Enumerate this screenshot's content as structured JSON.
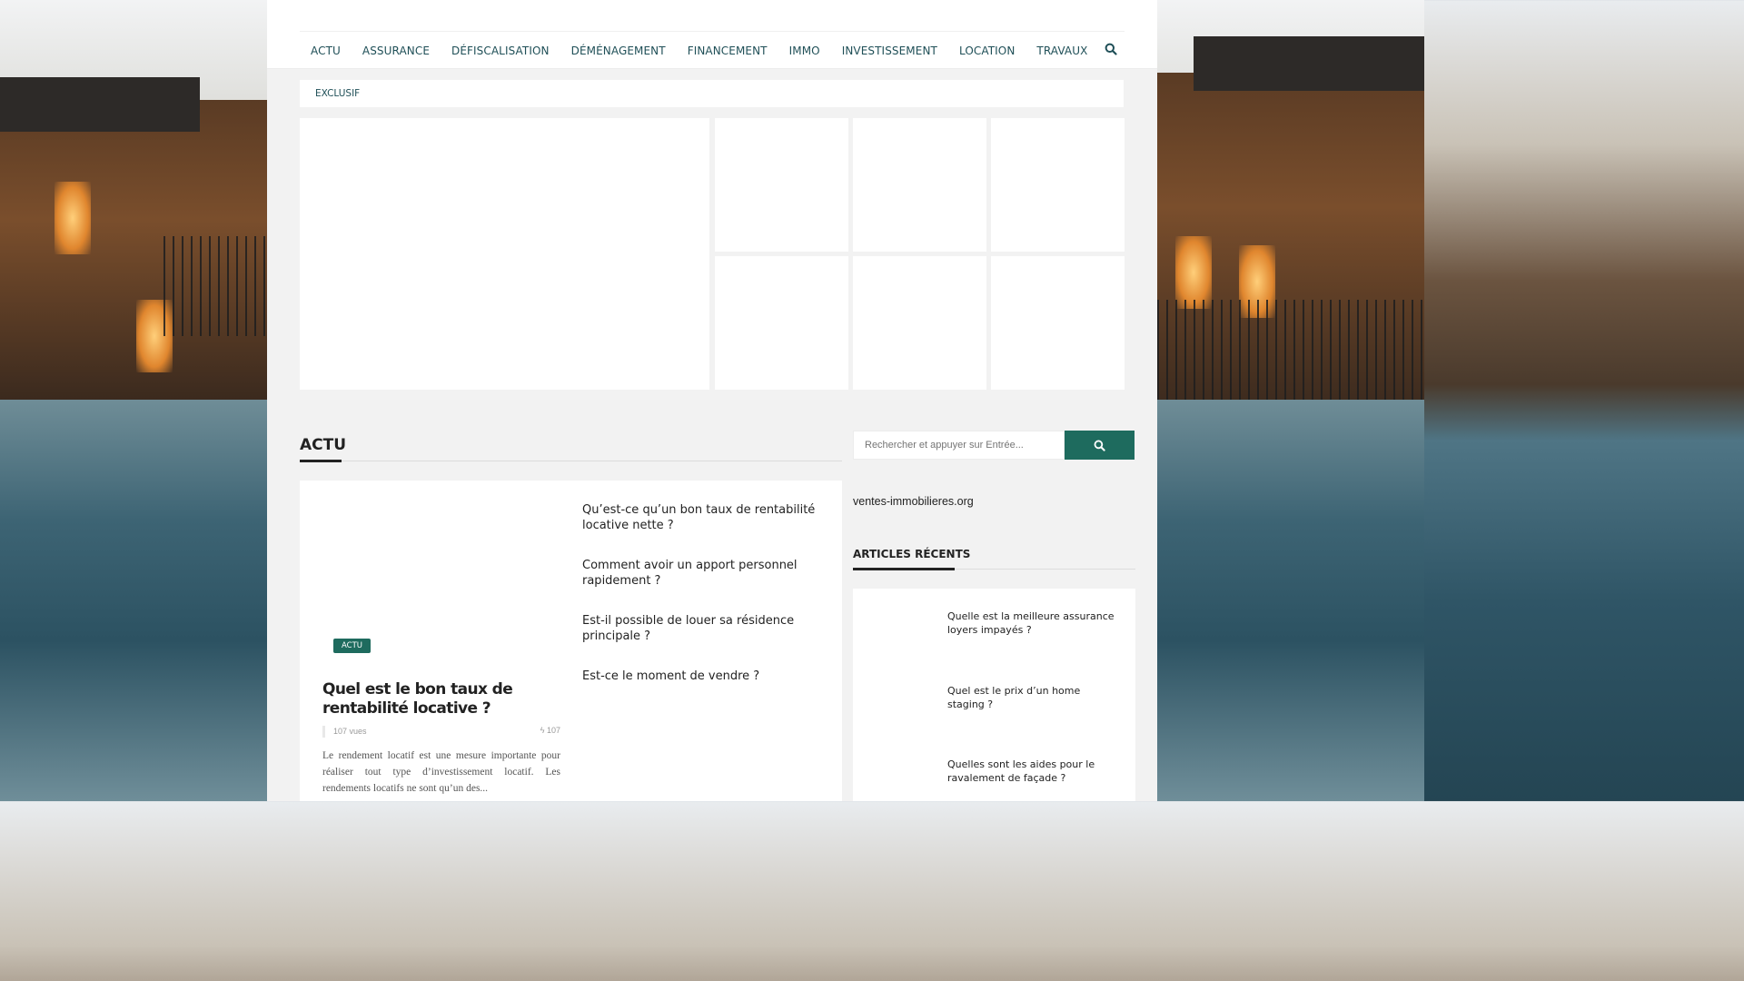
{
  "nav": {
    "items": [
      "ACTU",
      "ASSURANCE",
      "DÉFISCALISATION",
      "DÉMÉNAGEMENT",
      "FINANCEMENT",
      "IMMO",
      "INVESTISSEMENT",
      "LOCATION",
      "TRAVAUX"
    ],
    "search_icon": "search-icon"
  },
  "exclusif": {
    "label": "EXCLUSIF"
  },
  "actu_section": {
    "title": "ACTU",
    "featured": {
      "badge": "ACTU",
      "title": "Quel est le bon taux de rentabilité locative ?",
      "views": "107 vues",
      "count": "107",
      "excerpt": "Le rendement locatif est une mesure importante pour réaliser tout type d’investissement locatif. Les rendements locatifs ne sont qu’un des..."
    },
    "list": [
      "Qu’est-ce qu’un bon taux de rentabilité locative nette ?",
      "Comment avoir un apport personnel rapidement ?",
      "Est-il possible de louer sa résidence principale ?",
      "Est-ce le moment de vendre ?"
    ]
  },
  "sidebar": {
    "search_placeholder": "Rechercher et appuyer sur Entrée...",
    "domain": "ventes-immobilieres.org",
    "recent_title": "ARTICLES RÉCENTS",
    "recent": [
      "Quelle est la meilleure assurance loyers impayés ?",
      "Quel est le prix d’un home staging ?",
      "Quelles sont les aides pour le ravalement de façade ?"
    ]
  },
  "colors": {
    "accent": "#1e6b5e",
    "nav_text": "#1f4f57"
  }
}
